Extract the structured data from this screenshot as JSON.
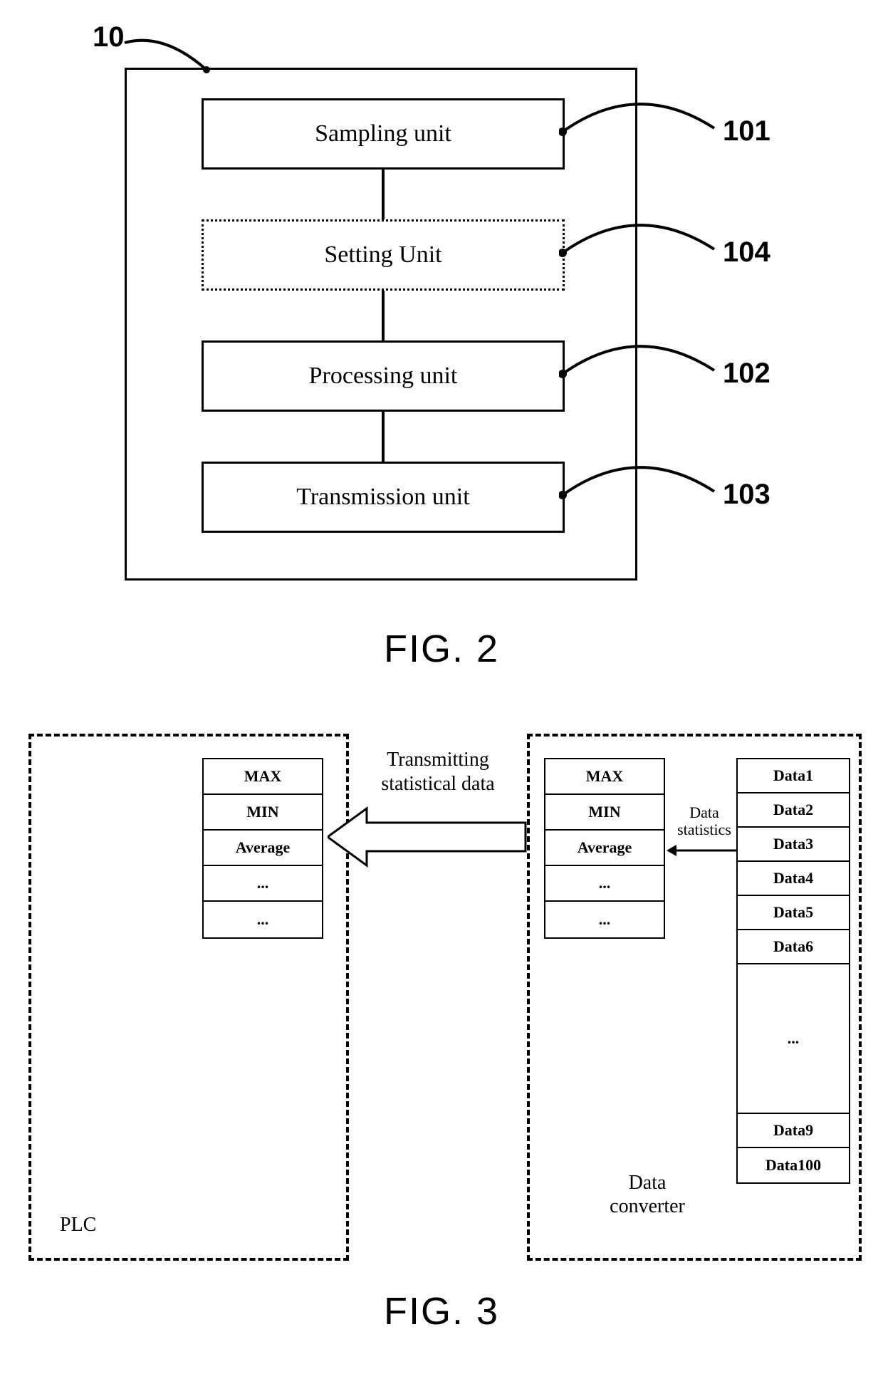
{
  "fig2": {
    "outer_ref": "10",
    "caption": "FIG. 2",
    "units": [
      {
        "label": "Sampling unit",
        "ref": "101",
        "dashed": false
      },
      {
        "label": "Setting Unit",
        "ref": "104",
        "dashed": true
      },
      {
        "label": "Processing unit",
        "ref": "102",
        "dashed": false
      },
      {
        "label": "Transmission unit",
        "ref": "103",
        "dashed": false
      }
    ]
  },
  "fig3": {
    "caption": "FIG. 3",
    "left_box_label": "PLC",
    "right_box_label": "Data converter",
    "transmit_label_line1": "Transmitting",
    "transmit_label_line2": "statistical data",
    "data_stats_label_line1": "Data",
    "data_stats_label_line2": "statistics",
    "stats_cells": [
      "MAX",
      "MIN",
      "Average",
      "...",
      "..."
    ],
    "data_cells": [
      "Data1",
      "Data2",
      "Data3",
      "Data4",
      "Data5",
      "Data6",
      "...",
      "Data9",
      "Data100"
    ]
  }
}
